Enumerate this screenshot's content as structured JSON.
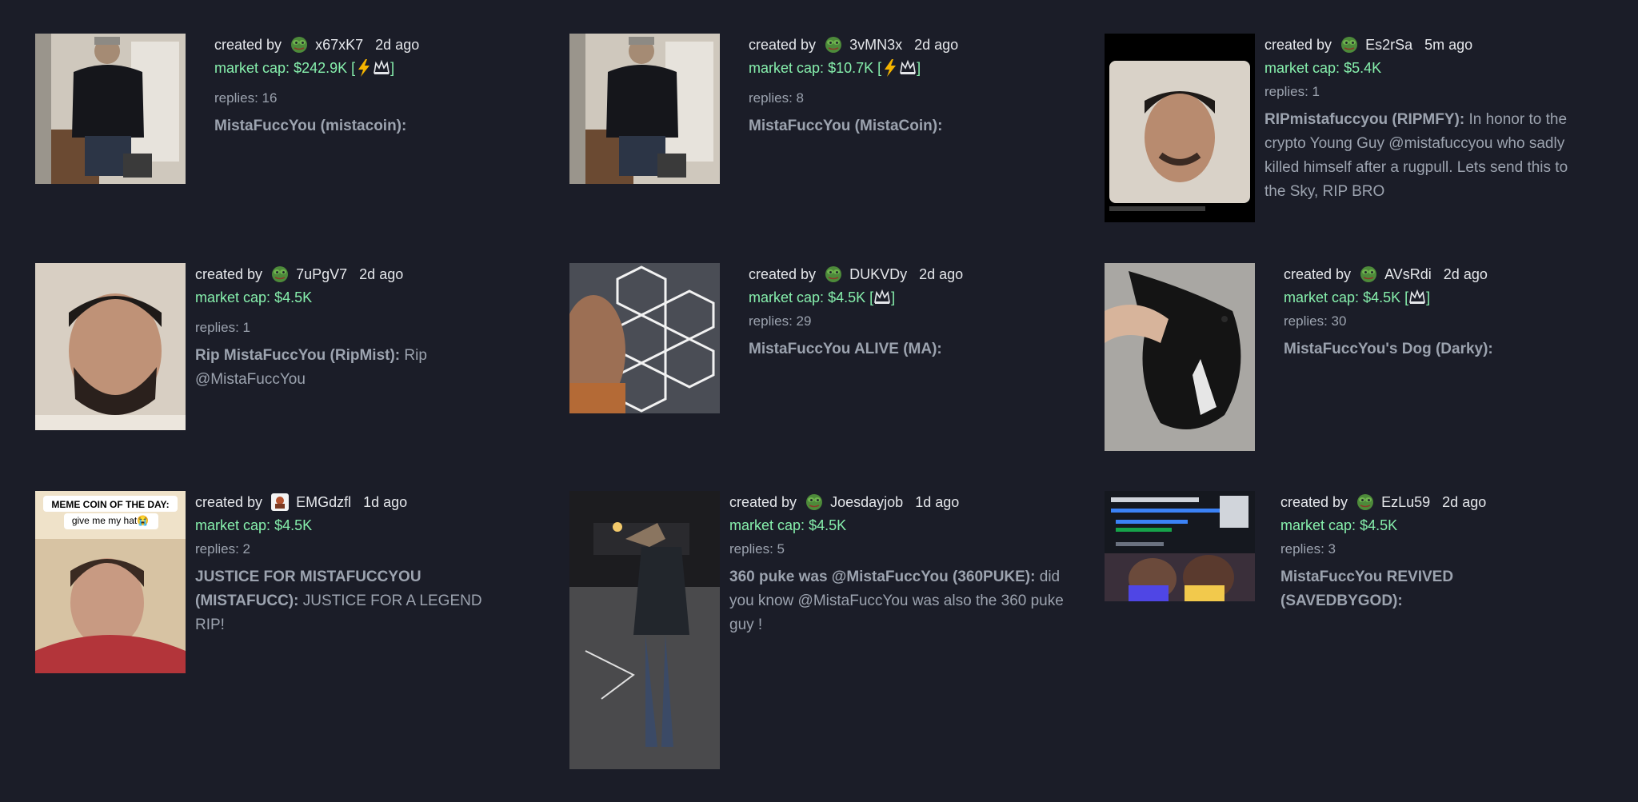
{
  "labels": {
    "created_by": "created by",
    "market_cap": "market cap:",
    "replies": "replies:"
  },
  "colors": {
    "background": "#1b1d28",
    "market_cap": "#86efac",
    "text_light": "#e5e7eb",
    "text_muted": "#9ca3af"
  },
  "coins": [
    {
      "creator": "x67xK7",
      "avatar": "pepe-frog-icon",
      "time": "2d ago",
      "market_cap": "$242.9K",
      "badges": "lightning-crown",
      "replies": "16",
      "title": "MistaFuccYou (mistacoin):",
      "description": "",
      "thumb": "man-black-puffer-jacket"
    },
    {
      "creator": "3vMN3x",
      "avatar": "pepe-frog-icon",
      "time": "2d ago",
      "market_cap": "$10.7K",
      "badges": "lightning-crown",
      "replies": "8",
      "title": "MistaFuccYou (MistaCoin):",
      "description": "",
      "thumb": "man-black-puffer-jacket"
    },
    {
      "creator": "Es2rSa",
      "avatar": "pepe-frog-icon",
      "time": "5m ago",
      "market_cap": "$5.4K",
      "badges": "",
      "replies": "1",
      "title": "RIPmistafuccyou (RIPMFY):",
      "description": "In honor to the crypto Young Guy @mistafuccyou who sadly killed himself after a rugpull. Lets send this to the Sky, RIP BRO",
      "thumb": "tweet-screenshot-face"
    },
    {
      "creator": "7uPgV7",
      "avatar": "pepe-frog-icon",
      "time": "2d ago",
      "market_cap": "$4.5K",
      "badges": "",
      "replies": "1",
      "title": "Rip MistaFuccYou (RipMist):",
      "description": "Rip @MistaFuccYou",
      "thumb": "man-face-closeup"
    },
    {
      "creator": "DUKVDy",
      "avatar": "pepe-frog-icon",
      "time": "2d ago",
      "market_cap": "$4.5K",
      "badges": "crown",
      "replies": "29",
      "title": "MistaFuccYou ALIVE (MA):",
      "description": "",
      "thumb": "hexagon-lights-selfie"
    },
    {
      "creator": "AVsRdi",
      "avatar": "pepe-frog-icon",
      "time": "2d ago",
      "market_cap": "$4.5K",
      "badges": "crown",
      "replies": "30",
      "title": "MistaFuccYou's Dog (Darky):",
      "description": "",
      "thumb": "black-dog"
    },
    {
      "creator": "EMGdzfl",
      "avatar": "hat-avatar-icon",
      "time": "1d ago",
      "market_cap": "$4.5K",
      "badges": "",
      "replies": "2",
      "title": "JUSTICE FOR MISTAFUCCYOU (MISTAFUCC):",
      "description": "JUSTICE FOR A LEGEND RIP!",
      "thumb": "meme-coin-of-the-day",
      "thumb_caption_1": "MEME COIN OF THE DAY:",
      "thumb_caption_2": "give me my hat😭"
    },
    {
      "creator": "Joesdayjob",
      "avatar": "pepe-frog-icon",
      "time": "1d ago",
      "market_cap": "$4.5K",
      "badges": "",
      "replies": "5",
      "title": "360 puke was @MistaFuccYou (360PUKE):",
      "description": "did you know @MistaFuccYou was also the 360 puke guy !",
      "thumb": "man-parking-lot-night"
    },
    {
      "creator": "EzLu59",
      "avatar": "pepe-frog-icon",
      "time": "2d ago",
      "market_cap": "$4.5K",
      "badges": "",
      "replies": "3",
      "title": "MistaFuccYou REVIVED (SAVEDBYGOD):",
      "description": "",
      "thumb": "tweet-basketball-screenshot"
    }
  ]
}
